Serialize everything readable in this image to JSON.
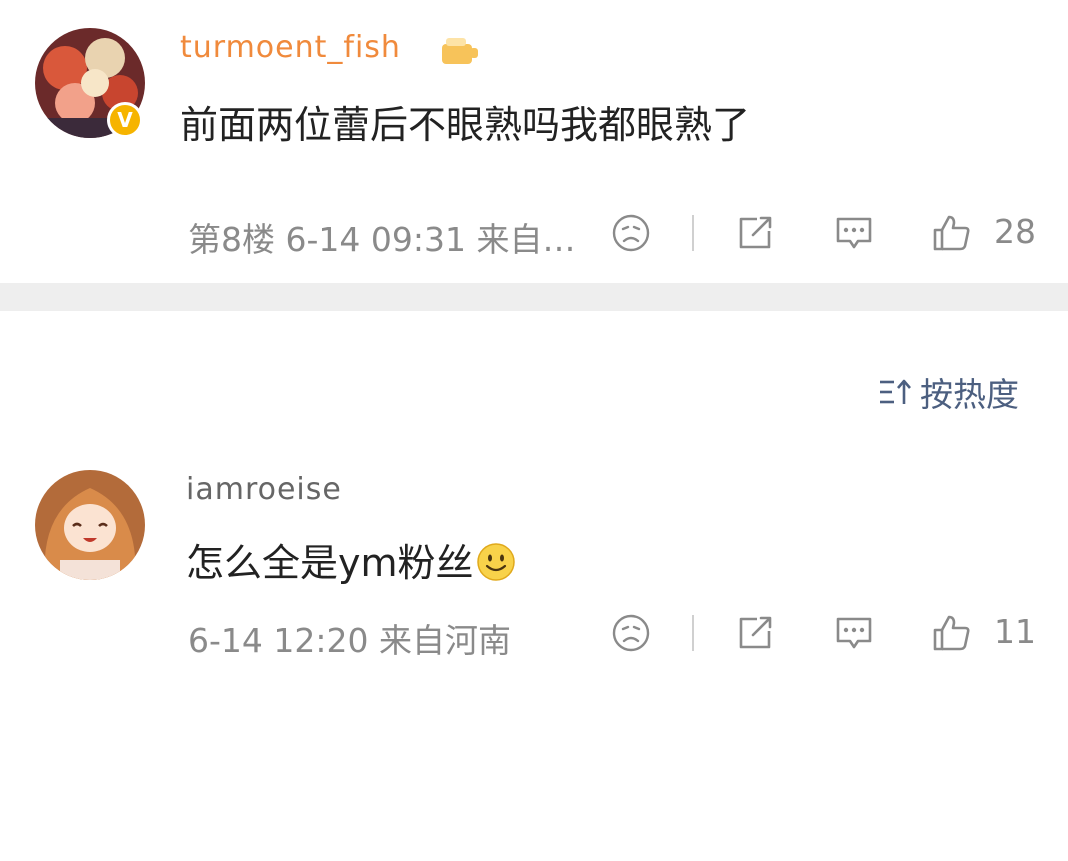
{
  "comments": [
    {
      "username": "turmoent_fish",
      "text": "前面两位蕾后不眼熟吗我都眼熟了",
      "meta": "第8楼 6-14 09:31 来自…",
      "likes": "28",
      "verified": true
    },
    {
      "username": "iamroeise",
      "text": "怎么全是ym粉丝",
      "meta": "6-14 12:20 来自河南",
      "likes": "11",
      "verified": false
    }
  ],
  "sort": {
    "label": "按热度"
  },
  "icons": {
    "dislike": "sad-face-icon",
    "share": "share-icon",
    "comment": "comment-bubble-icon",
    "like": "thumbs-up-icon",
    "sort": "sort-icon",
    "verified": "verified-badge-icon",
    "emoji": "smile-emoji-icon"
  },
  "colors": {
    "username": "#f08a3c",
    "meta": "#8a8a8a",
    "sort": "#4c5f80",
    "divider": "#eeeeee",
    "verified": "#f6b400"
  }
}
